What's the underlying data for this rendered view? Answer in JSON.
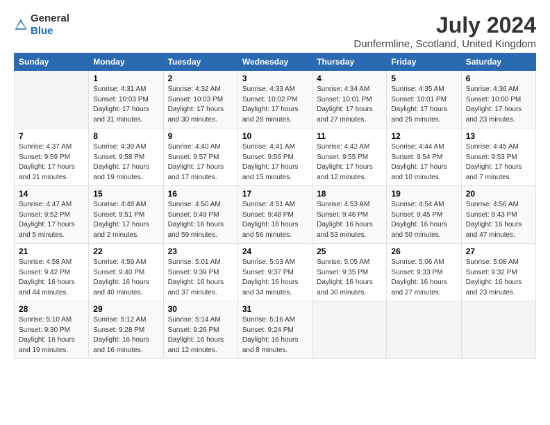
{
  "header": {
    "logo_general": "General",
    "logo_blue": "Blue",
    "title": "July 2024",
    "subtitle": "Dunfermline, Scotland, United Kingdom"
  },
  "weekdays": [
    "Sunday",
    "Monday",
    "Tuesday",
    "Wednesday",
    "Thursday",
    "Friday",
    "Saturday"
  ],
  "rows": [
    [
      {
        "day": "",
        "content": ""
      },
      {
        "day": "1",
        "content": "Sunrise: 4:31 AM\nSunset: 10:03 PM\nDaylight: 17 hours\nand 31 minutes."
      },
      {
        "day": "2",
        "content": "Sunrise: 4:32 AM\nSunset: 10:03 PM\nDaylight: 17 hours\nand 30 minutes."
      },
      {
        "day": "3",
        "content": "Sunrise: 4:33 AM\nSunset: 10:02 PM\nDaylight: 17 hours\nand 28 minutes."
      },
      {
        "day": "4",
        "content": "Sunrise: 4:34 AM\nSunset: 10:01 PM\nDaylight: 17 hours\nand 27 minutes."
      },
      {
        "day": "5",
        "content": "Sunrise: 4:35 AM\nSunset: 10:01 PM\nDaylight: 17 hours\nand 25 minutes."
      },
      {
        "day": "6",
        "content": "Sunrise: 4:36 AM\nSunset: 10:00 PM\nDaylight: 17 hours\nand 23 minutes."
      }
    ],
    [
      {
        "day": "7",
        "content": "Sunrise: 4:37 AM\nSunset: 9:59 PM\nDaylight: 17 hours\nand 21 minutes."
      },
      {
        "day": "8",
        "content": "Sunrise: 4:39 AM\nSunset: 9:58 PM\nDaylight: 17 hours\nand 19 minutes."
      },
      {
        "day": "9",
        "content": "Sunrise: 4:40 AM\nSunset: 9:57 PM\nDaylight: 17 hours\nand 17 minutes."
      },
      {
        "day": "10",
        "content": "Sunrise: 4:41 AM\nSunset: 9:56 PM\nDaylight: 17 hours\nand 15 minutes."
      },
      {
        "day": "11",
        "content": "Sunrise: 4:42 AM\nSunset: 9:55 PM\nDaylight: 17 hours\nand 12 minutes."
      },
      {
        "day": "12",
        "content": "Sunrise: 4:44 AM\nSunset: 9:54 PM\nDaylight: 17 hours\nand 10 minutes."
      },
      {
        "day": "13",
        "content": "Sunrise: 4:45 AM\nSunset: 9:53 PM\nDaylight: 17 hours\nand 7 minutes."
      }
    ],
    [
      {
        "day": "14",
        "content": "Sunrise: 4:47 AM\nSunset: 9:52 PM\nDaylight: 17 hours\nand 5 minutes."
      },
      {
        "day": "15",
        "content": "Sunrise: 4:48 AM\nSunset: 9:51 PM\nDaylight: 17 hours\nand 2 minutes."
      },
      {
        "day": "16",
        "content": "Sunrise: 4:50 AM\nSunset: 9:49 PM\nDaylight: 16 hours\nand 59 minutes."
      },
      {
        "day": "17",
        "content": "Sunrise: 4:51 AM\nSunset: 9:48 PM\nDaylight: 16 hours\nand 56 minutes."
      },
      {
        "day": "18",
        "content": "Sunrise: 4:53 AM\nSunset: 9:46 PM\nDaylight: 16 hours\nand 53 minutes."
      },
      {
        "day": "19",
        "content": "Sunrise: 4:54 AM\nSunset: 9:45 PM\nDaylight: 16 hours\nand 50 minutes."
      },
      {
        "day": "20",
        "content": "Sunrise: 4:56 AM\nSunset: 9:43 PM\nDaylight: 16 hours\nand 47 minutes."
      }
    ],
    [
      {
        "day": "21",
        "content": "Sunrise: 4:58 AM\nSunset: 9:42 PM\nDaylight: 16 hours\nand 44 minutes."
      },
      {
        "day": "22",
        "content": "Sunrise: 4:59 AM\nSunset: 9:40 PM\nDaylight: 16 hours\nand 40 minutes."
      },
      {
        "day": "23",
        "content": "Sunrise: 5:01 AM\nSunset: 9:39 PM\nDaylight: 16 hours\nand 37 minutes."
      },
      {
        "day": "24",
        "content": "Sunrise: 5:03 AM\nSunset: 9:37 PM\nDaylight: 16 hours\nand 34 minutes."
      },
      {
        "day": "25",
        "content": "Sunrise: 5:05 AM\nSunset: 9:35 PM\nDaylight: 16 hours\nand 30 minutes."
      },
      {
        "day": "26",
        "content": "Sunrise: 5:06 AM\nSunset: 9:33 PM\nDaylight: 16 hours\nand 27 minutes."
      },
      {
        "day": "27",
        "content": "Sunrise: 5:08 AM\nSunset: 9:32 PM\nDaylight: 16 hours\nand 23 minutes."
      }
    ],
    [
      {
        "day": "28",
        "content": "Sunrise: 5:10 AM\nSunset: 9:30 PM\nDaylight: 16 hours\nand 19 minutes."
      },
      {
        "day": "29",
        "content": "Sunrise: 5:12 AM\nSunset: 9:28 PM\nDaylight: 16 hours\nand 16 minutes."
      },
      {
        "day": "30",
        "content": "Sunrise: 5:14 AM\nSunset: 9:26 PM\nDaylight: 16 hours\nand 12 minutes."
      },
      {
        "day": "31",
        "content": "Sunrise: 5:16 AM\nSunset: 9:24 PM\nDaylight: 16 hours\nand 8 minutes."
      },
      {
        "day": "",
        "content": ""
      },
      {
        "day": "",
        "content": ""
      },
      {
        "day": "",
        "content": ""
      }
    ]
  ]
}
